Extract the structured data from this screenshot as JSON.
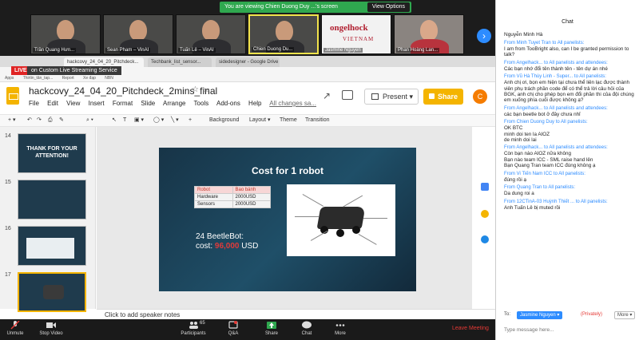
{
  "gallery": {
    "banner_text": "You are viewing Chien Duong Duy ...'s screen",
    "view_options": "View Options",
    "participants": [
      {
        "name": "Trần Quang Hưn..."
      },
      {
        "name": "Sean Pham – VinAI"
      },
      {
        "name": "Tuấn Lê – VinAI"
      },
      {
        "name": "Chien Duong Du..."
      },
      {
        "name": "Jasmine Nguyen",
        "logo": "ongelhock",
        "logo_sub": "VIETNAM"
      },
      {
        "name": "Phan Hoàng Lan..."
      }
    ]
  },
  "browser": {
    "tabs": [
      "on Custom Live Streaming Service",
      "hackcovy_24_04_20_Pitchdeck...",
      "Techbank_list_sensor...",
      "sidedesigner - Google Drive"
    ],
    "live_badge": "LIVE",
    "live_title": "on Custom Live Streaming Service",
    "bookmarks": [
      "Apps",
      "Thirtin_tăn_tap...",
      "Report",
      "Xe đạp",
      "NBN"
    ]
  },
  "doc": {
    "title": "hackcovy_24_04_20_Pitchdeck_2mins_final",
    "menu": [
      "File",
      "Edit",
      "View",
      "Insert",
      "Format",
      "Slide",
      "Arrange",
      "Tools",
      "Add-ons",
      "Help"
    ],
    "saving": "All changes sa...",
    "present_label": "Present",
    "share_label": "Share",
    "avatar_letter": "C"
  },
  "toolbar": {
    "background": "Background",
    "layout": "Layout ▾",
    "theme": "Theme",
    "transition": "Transition"
  },
  "filmstrip": {
    "slides": [
      {
        "num": "14",
        "title": "THANK FOR YOUR ATTENTION!"
      },
      {
        "num": "15",
        "title": ""
      },
      {
        "num": "16",
        "title": ""
      },
      {
        "num": "17",
        "title": ""
      }
    ]
  },
  "slide": {
    "title": "Cost for 1 robot",
    "table": [
      [
        "Robot",
        "Bao bánh"
      ],
      [
        "Hardware",
        "2000USD"
      ],
      [
        "Sensors",
        "2000USD"
      ]
    ],
    "cost_line1": "24 BeetleBot:",
    "cost_prefix": "cost:",
    "cost_amount": "96,000",
    "cost_unit": "USD"
  },
  "notes": {
    "placeholder": "Click to add speaker notes"
  },
  "controls": {
    "unmute": "Unmute",
    "stop_video": "Stop Video",
    "participants": "Participants",
    "participants_count": "65",
    "qa": "Q&A",
    "share": "Share",
    "chat": "Chat",
    "more": "More",
    "leave": "Leave Meeting"
  },
  "chat": {
    "title": "Chat",
    "first_name": "Nguyễn Minh Hà",
    "messages": [
      {
        "from": "From Minh Tuyet Tran to All panelists:",
        "text": "I am from TooBright also, can I be granted permission to talk?"
      },
      {
        "from": "From Angelhack... to All panelists and attendees:",
        "text": "Các bạn nhớ đổi tên thành tên - tên dự án nhé"
      },
      {
        "from": "From Vũ Hà Thùy Linh - Super... to All panelists:",
        "text": "Anh chị ơi, bọn em hiện tại chưa thể liên lạc được thành viên phụ trách phần code để có thể trả lời câu hỏi của BGK, anh chị cho phép bọn em đổi phần thi của đội chúng em xuống phía cuối được không ạ?"
      },
      {
        "from": "From Angelhack... to All panelists and attendees:",
        "text": "các bạn beetle bot ở đây chưa nhỉ"
      },
      {
        "from": "From Chien Duong Duy to All panelists:",
        "text": "OK BTC\nminh doi ten la AIOZ\nde minh doi lai"
      },
      {
        "from": "From Angelhack... to All panelists and attendees:",
        "text": "Còn bạn nào AIOZ nữa không\nBạn nào team ICC - SML raise hand lên\nBạn Quang Tran team ICC đúng không ạ"
      },
      {
        "from": "From Vi Tiến Nam ICC to All panelists:",
        "text": "đúng rồi ạ"
      },
      {
        "from": "From Quang Tran to All panelists:",
        "text": "Da dung roi a"
      },
      {
        "from": "From 12CTinA-03 Huỳnh Thiết ... to All panelists:",
        "text": "Anh Tuấn Lê bị muted rồi"
      }
    ],
    "to_label": "To:",
    "to_value": "Jasmine Nguyen ▾",
    "privately": "(Privately)",
    "more_label": "More ▾",
    "input_placeholder": "Type message here..."
  }
}
